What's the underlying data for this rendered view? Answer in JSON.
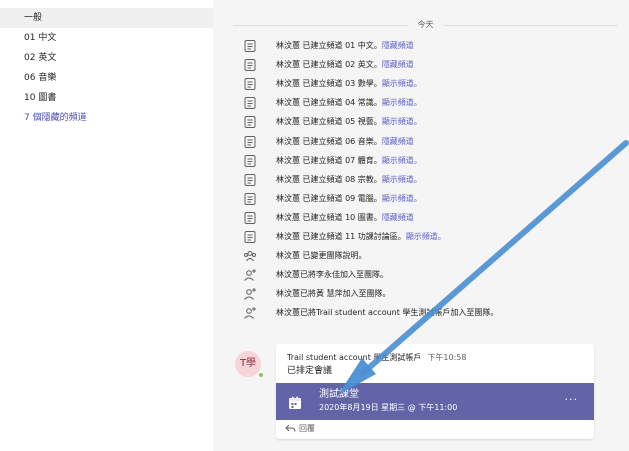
{
  "sidebar": {
    "items": [
      {
        "label": "一般"
      },
      {
        "label": "01 中文"
      },
      {
        "label": "02 英文"
      },
      {
        "label": "06 音樂"
      },
      {
        "label": "10 圖書"
      },
      {
        "label": "7 個隱藏的頻道"
      }
    ]
  },
  "feed": {
    "date_separator": "今天",
    "rows": [
      {
        "icon": "channel-icon",
        "text": "林汶蕙 已建立頻道 01 中文。",
        "link": "隱藏頻道"
      },
      {
        "icon": "channel-icon",
        "text": "林汶蕙 已建立頻道 02 英文。",
        "link": "隱藏頻道"
      },
      {
        "icon": "channel-icon",
        "text": "林汶蕙 已建立頻道 03 數學。",
        "link": "顯示頻道。"
      },
      {
        "icon": "channel-icon",
        "text": "林汶蕙 已建立頻道 04 常識。",
        "link": "顯示頻道。"
      },
      {
        "icon": "channel-icon",
        "text": "林汶蕙 已建立頻道 05 視藝。",
        "link": "顯示頻道。"
      },
      {
        "icon": "channel-icon",
        "text": "林汶蕙 已建立頻道 06 音樂。",
        "link": "隱藏頻道"
      },
      {
        "icon": "channel-icon",
        "text": "林汶蕙 已建立頻道 07 體育。",
        "link": "顯示頻道。"
      },
      {
        "icon": "channel-icon",
        "text": "林汶蕙 已建立頻道 08 宗教。",
        "link": "顯示頻道。"
      },
      {
        "icon": "channel-icon",
        "text": "林汶蕙 已建立頻道 09 電腦。",
        "link": "顯示頻道。"
      },
      {
        "icon": "channel-icon",
        "text": "林汶蕙 已建立頻道 10 圖書。",
        "link": "隱藏頻道"
      },
      {
        "icon": "channel-icon",
        "text": "林汶蕙 已建立頻道 11 功課討論區。",
        "link": "顯示頻道。"
      },
      {
        "icon": "team-icon",
        "text": "林汶蕙 已變更團隊說明。",
        "link": ""
      },
      {
        "icon": "add-person-icon",
        "text": "林汶蕙已將李永佳加入至團隊。",
        "link": ""
      },
      {
        "icon": "add-person-icon",
        "text": "林汶蕙已將黃 慧萍加入至團隊。",
        "link": ""
      },
      {
        "icon": "add-person-icon",
        "text": "林汶蕙已將Trail student account 學生測試帳戶加入至團隊。",
        "link": ""
      }
    ]
  },
  "message": {
    "avatar_initials": "T學",
    "sender": "Trail student account 學生測試帳戶",
    "time": "下午10:58",
    "subtitle": "已排定會議",
    "meeting": {
      "title": "測試課堂",
      "datetime": "2020年8月19日 星期三 @ 下午11:00",
      "more": "···"
    },
    "reply_label": "回覆"
  },
  "colors": {
    "accent": "#6264a7",
    "link": "#5b5fc7",
    "arrow": "#3d86c6",
    "presence": "#92c353"
  }
}
